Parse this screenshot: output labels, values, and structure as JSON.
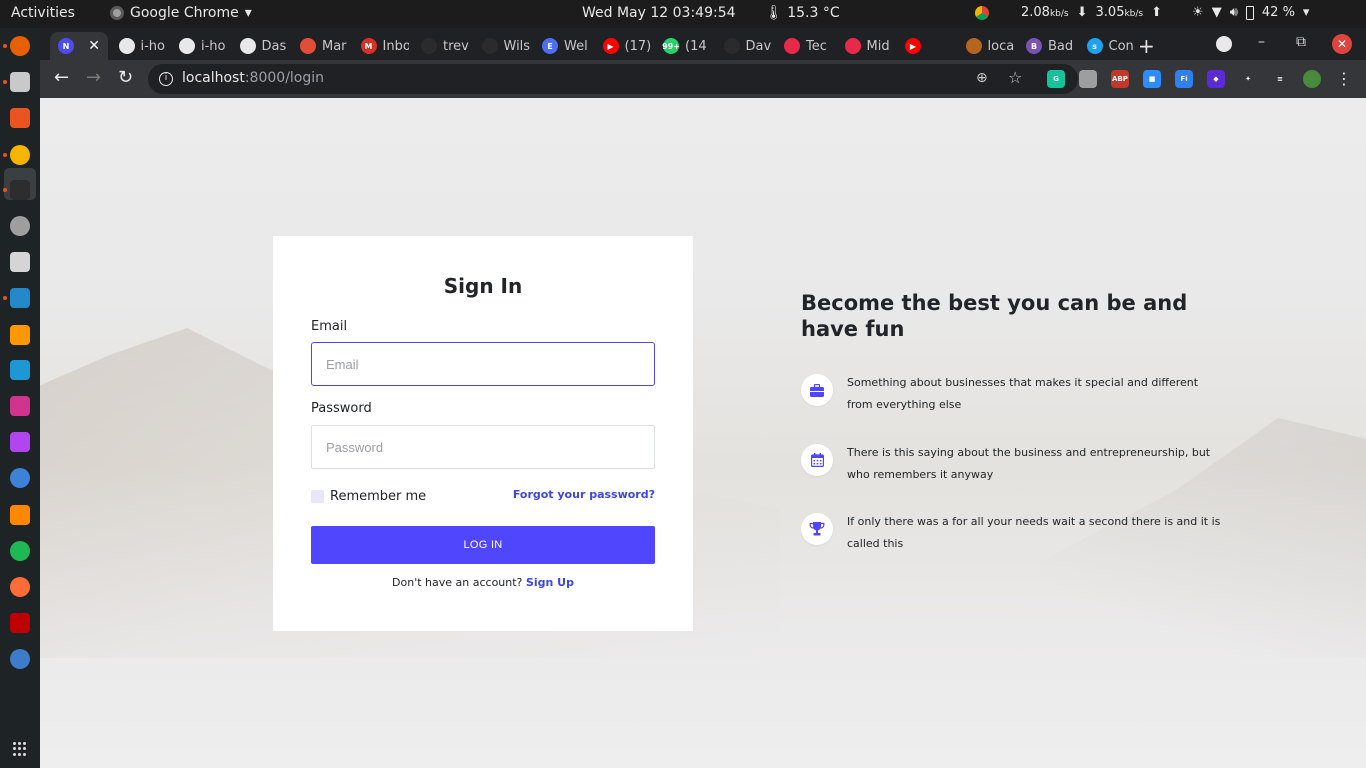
{
  "topbar": {
    "activities": "Activities",
    "app_name": "Google Chrome",
    "app_menu_arrow": "▾",
    "datetime": "Wed May 12  03:49:54",
    "weather": "15.3 °C",
    "net_down_value": "2.08",
    "net_down_unit": "kb/s",
    "net_up_value": "3.05",
    "net_up_unit": "kb/s",
    "battery": "42 %"
  },
  "tabs": [
    {
      "title": "",
      "favicon": "N",
      "color": "#4c4cf0",
      "active": true
    },
    {
      "title": "i-ho",
      "favicon": "",
      "color": "#e8e8e8"
    },
    {
      "title": "i-ho",
      "favicon": "",
      "color": "#e8e8e8"
    },
    {
      "title": "Das",
      "favicon": "",
      "color": "#e8e8e8"
    },
    {
      "title": "Mar",
      "favicon": "",
      "color": "#e04e39"
    },
    {
      "title": "Inbo",
      "favicon": "M",
      "color": "#d93025"
    },
    {
      "title": "trev",
      "favicon": "",
      "color": "#2b2b2b"
    },
    {
      "title": "Wils",
      "favicon": "",
      "color": "#2b2b2b"
    },
    {
      "title": "Wel",
      "favicon": "E",
      "color": "#4c6ef5"
    },
    {
      "title": "(17)",
      "favicon": "▶",
      "color": "#ff0000"
    },
    {
      "title": "(14",
      "favicon": "99+",
      "color": "#25d366"
    },
    {
      "title": "Dav",
      "favicon": "",
      "color": "#2b2b2b"
    },
    {
      "title": "Tec",
      "favicon": "",
      "color": "#e8294a"
    },
    {
      "title": "Mid",
      "favicon": "",
      "color": "#e8294a"
    },
    {
      "title": "",
      "favicon": "▶",
      "color": "#ff0000"
    },
    {
      "title": "loca",
      "favicon": "",
      "color": "#b5651d"
    },
    {
      "title": "Bad",
      "favicon": "B",
      "color": "#7952b3"
    },
    {
      "title": "Con",
      "favicon": "s",
      "color": "#1da1f2"
    }
  ],
  "tabstrip": {
    "close_glyph": "✕",
    "new_tab": "+",
    "minimize": "–",
    "maximize": "⧉",
    "window_close": "✕"
  },
  "toolbar": {
    "back": "←",
    "forward": "→",
    "reload": "↻",
    "info_glyph": "i",
    "url_host": "localhost",
    "url_path": ":8000/login",
    "zoom_glyph": "⊕",
    "star_glyph": "☆",
    "menu_glyph": "⋮"
  },
  "extensions": [
    {
      "name": "grammarly",
      "label": "G",
      "color": "#15c39a"
    },
    {
      "name": "ext-gray",
      "label": "",
      "color": "#9e9e9e"
    },
    {
      "name": "adblock-plus",
      "label": "ABP",
      "color": "#c0392b"
    },
    {
      "name": "zoom",
      "label": "■",
      "color": "#2d8cff"
    },
    {
      "name": "fi",
      "label": "Fi",
      "color": "#2f80ed"
    },
    {
      "name": "ext-purple",
      "label": "◆",
      "color": "#5b2bd6"
    },
    {
      "name": "puzzle",
      "label": "✦",
      "color": "#35363a"
    },
    {
      "name": "media",
      "label": "≡",
      "color": "#35363a"
    },
    {
      "name": "avatar",
      "label": "",
      "color": "#4a8a3c"
    }
  ],
  "dock": {
    "apps": [
      {
        "name": "firefox",
        "color": "#e66000"
      },
      {
        "name": "files",
        "color": "#c9c9c9"
      },
      {
        "name": "software",
        "color": "#e95420"
      },
      {
        "name": "chrome",
        "color": "#f4b400"
      },
      {
        "name": "terminal",
        "color": "#2d2d2d"
      },
      {
        "name": "settings",
        "color": "#9e9e9e"
      },
      {
        "name": "ext",
        "color": "#d5d5d5"
      },
      {
        "name": "vscode",
        "color": "#2489ca"
      },
      {
        "name": "sublime",
        "color": "#ff9800"
      },
      {
        "name": "webstorm",
        "color": "#1d98d4"
      },
      {
        "name": "intellij",
        "color": "#d0348e"
      },
      {
        "name": "phpstorm",
        "color": "#b345f1"
      },
      {
        "name": "remmina",
        "color": "#3d82d6"
      },
      {
        "name": "vlc",
        "color": "#ff8800"
      },
      {
        "name": "spotify",
        "color": "#1db954"
      },
      {
        "name": "postman",
        "color": "#ff6c37"
      },
      {
        "name": "filezilla",
        "color": "#bf0000"
      },
      {
        "name": "qbittorrent",
        "color": "#3d7cc9"
      }
    ]
  },
  "login": {
    "title": "Sign In",
    "email_label": "Email",
    "email_placeholder": "Email",
    "password_label": "Password",
    "password_placeholder": "Password",
    "remember_label": "Remember me",
    "forgot_link": "Forgot your password?",
    "submit_label": "LOG IN",
    "no_account_text": "Don't have an account?",
    "signup_link": "Sign Up"
  },
  "promo": {
    "heading": "Become the best you can be and have fun",
    "features": [
      {
        "icon": "briefcase-icon",
        "text": "Something about businesses that makes it special and different from everything else"
      },
      {
        "icon": "calendar-icon",
        "text": "There is this saying about the business and entrepreneurship, but who remembers it anyway"
      },
      {
        "icon": "trophy-icon",
        "text": "If only there was a for all your needs wait a second there is and it is called this"
      }
    ]
  },
  "colors": {
    "accent": "#4f46fe",
    "link": "#3b47e0",
    "focus_border": "#4f46e5"
  }
}
